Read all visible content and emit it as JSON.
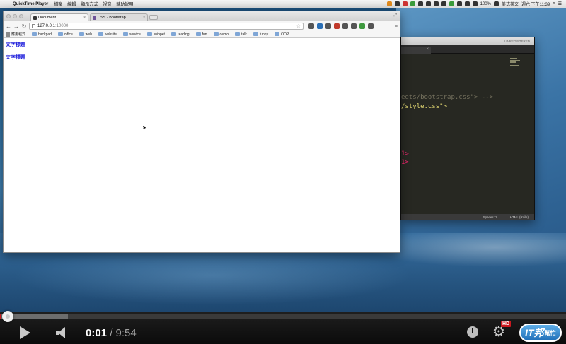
{
  "menubar": {
    "app_name": "QuickTime Player",
    "items": [
      "檔案",
      "編輯",
      "顯示方式",
      "視窗",
      "輔助說明"
    ],
    "input_source": "美式英文",
    "battery": "100%",
    "clock": "週六 下午11:39"
  },
  "browser": {
    "tabs": [
      {
        "label": "Document",
        "active": true
      },
      {
        "label": "CSS · Bootstrap",
        "active": false
      }
    ],
    "url_host": "127.0.0.1",
    "url_port": ":10000",
    "bookmarks": [
      "應用程式",
      "hackpad",
      "office",
      "web",
      "website",
      "service",
      "snippet",
      "reading",
      "fun",
      "demo",
      "talk",
      "funny",
      "OOP"
    ],
    "page_headings": [
      "文字標題",
      "文字標題"
    ]
  },
  "editor": {
    "title": "UNREGISTERED",
    "code_lines": [
      {
        "text": "eets/bootstrap.css\"> -->",
        "style": "comment"
      },
      {
        "text": "/style.css\">",
        "style": "string"
      },
      {
        "text": "1>",
        "style": "tag"
      },
      {
        "text": "1>",
        "style": "tag"
      }
    ],
    "status_spaces": "Spaces: 2",
    "status_syntax": "HTML (Rails)"
  },
  "player": {
    "current_time": "0:01",
    "separator": "/",
    "duration": "9:54",
    "played_fraction": 0.002,
    "loaded_fraction": 0.12,
    "hd_label": "HD",
    "logo_text": "IT邦",
    "logo_sub": "幫忙"
  }
}
